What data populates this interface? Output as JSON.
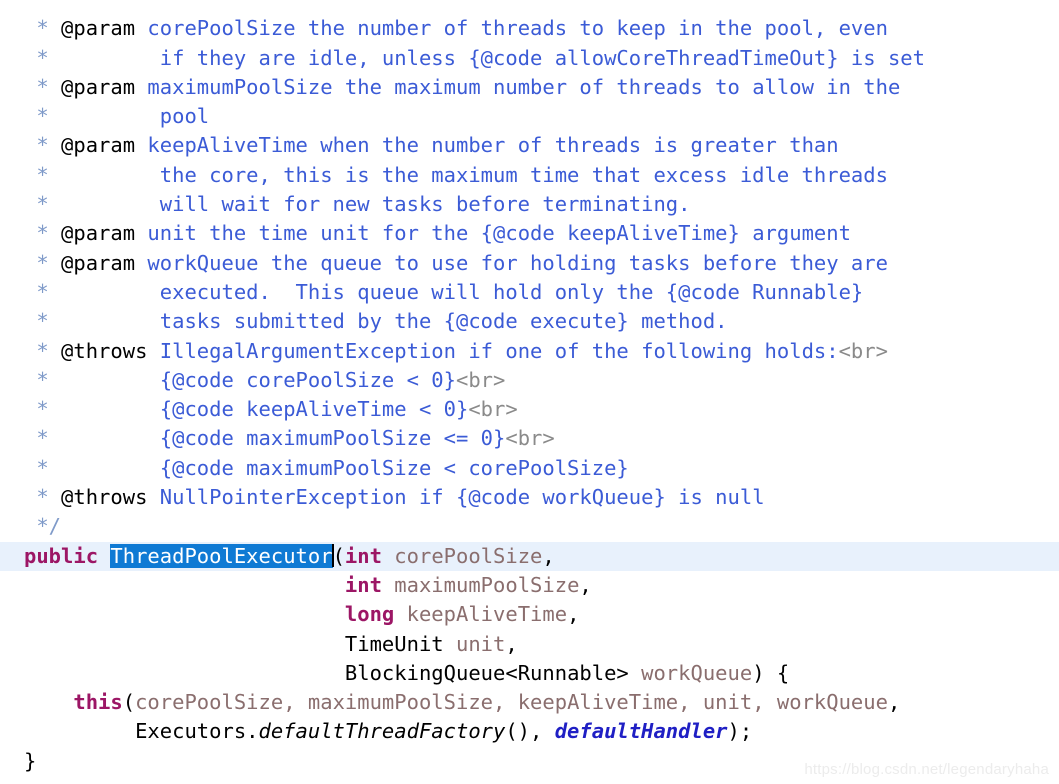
{
  "editor": {
    "language": "java",
    "colors": {
      "background": "#ffffff",
      "current_line_highlight": "#e8f1fc",
      "selection_background": "#0f7ad4",
      "selection_foreground": "#ffffff",
      "javadoc_text": "#3b5bd6",
      "javadoc_marker": "#7f9ac9",
      "keyword": "#9c1665",
      "parameter": "#8a6e6e",
      "type": "#000000",
      "html_tag": "#8a8a8a",
      "static_field": "#1f1fc4",
      "watermark": "#ececec"
    },
    "selection_text": "ThreadPoolExecutor"
  },
  "watermark": {
    "text": "https://blog.csdn.net/legendaryhaha"
  },
  "lines": [
    {
      "id": "l01",
      "current": false,
      "tokens": [
        {
          "cls": "t-doc-mark",
          "text": " * "
        }
      ]
    },
    {
      "id": "l02",
      "current": false,
      "tokens": [
        {
          "cls": "t-doc-mark",
          "text": " * "
        },
        {
          "cls": "t-doc-tag",
          "text": "@param"
        },
        {
          "cls": "t-doc",
          "text": " corePoolSize the number of threads to keep in the pool, even"
        }
      ]
    },
    {
      "id": "l03",
      "current": false,
      "tokens": [
        {
          "cls": "t-doc-mark",
          "text": " * "
        },
        {
          "cls": "t-doc",
          "text": "        if they are idle, unless {@code allowCoreThreadTimeOut} is set"
        }
      ]
    },
    {
      "id": "l04",
      "current": false,
      "tokens": [
        {
          "cls": "t-doc-mark",
          "text": " * "
        },
        {
          "cls": "t-doc-tag",
          "text": "@param"
        },
        {
          "cls": "t-doc",
          "text": " maximumPoolSize the maximum number of threads to allow in the"
        }
      ]
    },
    {
      "id": "l05",
      "current": false,
      "tokens": [
        {
          "cls": "t-doc-mark",
          "text": " * "
        },
        {
          "cls": "t-doc",
          "text": "        pool"
        }
      ]
    },
    {
      "id": "l06",
      "current": false,
      "tokens": [
        {
          "cls": "t-doc-mark",
          "text": " * "
        },
        {
          "cls": "t-doc-tag",
          "text": "@param"
        },
        {
          "cls": "t-doc",
          "text": " keepAliveTime when the number of threads is greater than"
        }
      ]
    },
    {
      "id": "l07",
      "current": false,
      "tokens": [
        {
          "cls": "t-doc-mark",
          "text": " * "
        },
        {
          "cls": "t-doc",
          "text": "        the core, this is the maximum time that excess idle threads"
        }
      ]
    },
    {
      "id": "l08",
      "current": false,
      "tokens": [
        {
          "cls": "t-doc-mark",
          "text": " * "
        },
        {
          "cls": "t-doc",
          "text": "        will wait for new tasks before terminating."
        }
      ]
    },
    {
      "id": "l09",
      "current": false,
      "tokens": [
        {
          "cls": "t-doc-mark",
          "text": " * "
        },
        {
          "cls": "t-doc-tag",
          "text": "@param"
        },
        {
          "cls": "t-doc",
          "text": " unit the time unit for the {@code keepAliveTime} argument"
        }
      ]
    },
    {
      "id": "l10",
      "current": false,
      "tokens": [
        {
          "cls": "t-doc-mark",
          "text": " * "
        },
        {
          "cls": "t-doc-tag",
          "text": "@param"
        },
        {
          "cls": "t-doc",
          "text": " workQueue the queue to use for holding tasks before they are"
        }
      ]
    },
    {
      "id": "l11",
      "current": false,
      "tokens": [
        {
          "cls": "t-doc-mark",
          "text": " * "
        },
        {
          "cls": "t-doc",
          "text": "        executed.  This queue will hold only the {@code Runnable}"
        }
      ]
    },
    {
      "id": "l12",
      "current": false,
      "tokens": [
        {
          "cls": "t-doc-mark",
          "text": " * "
        },
        {
          "cls": "t-doc",
          "text": "        tasks submitted by the {@code execute} method."
        }
      ]
    },
    {
      "id": "l13",
      "current": false,
      "tokens": [
        {
          "cls": "t-doc-mark",
          "text": " * "
        },
        {
          "cls": "t-doc-tag",
          "text": "@throws"
        },
        {
          "cls": "t-doc",
          "text": " IllegalArgumentException if one of the following holds:"
        },
        {
          "cls": "t-html-tag",
          "text": "<br>"
        }
      ]
    },
    {
      "id": "l14",
      "current": false,
      "tokens": [
        {
          "cls": "t-doc-mark",
          "text": " * "
        },
        {
          "cls": "t-doc",
          "text": "        {@code corePoolSize < 0}"
        },
        {
          "cls": "t-html-tag",
          "text": "<br>"
        }
      ]
    },
    {
      "id": "l15",
      "current": false,
      "tokens": [
        {
          "cls": "t-doc-mark",
          "text": " * "
        },
        {
          "cls": "t-doc",
          "text": "        {@code keepAliveTime < 0}"
        },
        {
          "cls": "t-html-tag",
          "text": "<br>"
        }
      ]
    },
    {
      "id": "l16",
      "current": false,
      "tokens": [
        {
          "cls": "t-doc-mark",
          "text": " * "
        },
        {
          "cls": "t-doc",
          "text": "        {@code maximumPoolSize <= 0}"
        },
        {
          "cls": "t-html-tag",
          "text": "<br>"
        }
      ]
    },
    {
      "id": "l17",
      "current": false,
      "tokens": [
        {
          "cls": "t-doc-mark",
          "text": " * "
        },
        {
          "cls": "t-doc",
          "text": "        {@code maximumPoolSize < corePoolSize}"
        }
      ]
    },
    {
      "id": "l18",
      "current": false,
      "tokens": [
        {
          "cls": "t-doc-mark",
          "text": " * "
        },
        {
          "cls": "t-doc-tag",
          "text": "@throws"
        },
        {
          "cls": "t-doc",
          "text": " NullPointerException if {@code workQueue} is null"
        }
      ]
    },
    {
      "id": "l19",
      "current": false,
      "tokens": [
        {
          "cls": "t-doc-mark",
          "text": " */"
        }
      ]
    },
    {
      "id": "l20",
      "current": true,
      "tokens": [
        {
          "cls": "t-keyword",
          "text": "public "
        },
        {
          "cls": "selection",
          "text": "ThreadPoolExecutor"
        },
        {
          "cls": "caret",
          "text": ""
        },
        {
          "cls": "t-plain",
          "text": "("
        },
        {
          "cls": "t-keyword",
          "text": "int"
        },
        {
          "cls": "t-param",
          "text": " corePoolSize"
        },
        {
          "cls": "t-plain",
          "text": ","
        }
      ]
    },
    {
      "id": "l21",
      "current": false,
      "tokens": [
        {
          "cls": "t-plain",
          "text": "                          "
        },
        {
          "cls": "t-keyword",
          "text": "int"
        },
        {
          "cls": "t-param",
          "text": " maximumPoolSize"
        },
        {
          "cls": "t-plain",
          "text": ","
        }
      ]
    },
    {
      "id": "l22",
      "current": false,
      "tokens": [
        {
          "cls": "t-plain",
          "text": "                          "
        },
        {
          "cls": "t-keyword",
          "text": "long"
        },
        {
          "cls": "t-param",
          "text": " keepAliveTime"
        },
        {
          "cls": "t-plain",
          "text": ","
        }
      ]
    },
    {
      "id": "l23",
      "current": false,
      "tokens": [
        {
          "cls": "t-plain",
          "text": "                          "
        },
        {
          "cls": "t-type",
          "text": "TimeUnit"
        },
        {
          "cls": "t-param",
          "text": " unit"
        },
        {
          "cls": "t-plain",
          "text": ","
        }
      ]
    },
    {
      "id": "l24",
      "current": false,
      "tokens": [
        {
          "cls": "t-plain",
          "text": "                          "
        },
        {
          "cls": "t-type",
          "text": "BlockingQueue<Runnable>"
        },
        {
          "cls": "t-param",
          "text": " workQueue"
        },
        {
          "cls": "t-plain",
          "text": ") {"
        }
      ]
    },
    {
      "id": "l25",
      "current": false,
      "tokens": [
        {
          "cls": "t-plain",
          "text": "    "
        },
        {
          "cls": "t-keyword",
          "text": "this"
        },
        {
          "cls": "t-plain",
          "text": "("
        },
        {
          "cls": "t-param",
          "text": "corePoolSize, maximumPoolSize, keepAliveTime, unit, workQueue"
        },
        {
          "cls": "t-plain",
          "text": ","
        }
      ]
    },
    {
      "id": "l26",
      "current": false,
      "tokens": [
        {
          "cls": "t-plain",
          "text": "         Executors."
        },
        {
          "cls": "t-method-italic",
          "text": "defaultThreadFactory"
        },
        {
          "cls": "t-plain",
          "text": "(), "
        },
        {
          "cls": "t-static-field",
          "text": "defaultHandler"
        },
        {
          "cls": "t-plain",
          "text": ");"
        }
      ]
    },
    {
      "id": "l27",
      "current": false,
      "tokens": [
        {
          "cls": "t-plain",
          "text": "}"
        }
      ]
    }
  ]
}
